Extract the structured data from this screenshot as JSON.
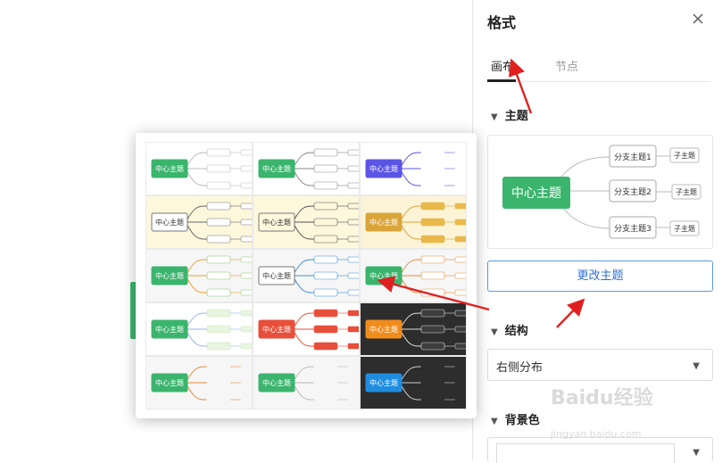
{
  "panel": {
    "title": "格式",
    "tabs": [
      {
        "label": "画布",
        "active": true
      },
      {
        "label": "节点",
        "active": false
      }
    ],
    "theme_section": {
      "label": "主题",
      "preview": {
        "center": "中心主题",
        "branches": [
          "分支主题1",
          "分支主题2",
          "分支主题3"
        ],
        "sub": "子主题"
      },
      "change_button": "更改主题"
    },
    "structure_section": {
      "label": "结构",
      "value": "右侧分布"
    },
    "background_section": {
      "label": "背景色"
    }
  },
  "theme_picker": {
    "center_label": "中心主题",
    "themes": [
      {
        "bg": "#ffffff",
        "center": "#3bb56d",
        "center_text": "#ffffff",
        "line": "#bbbbbb",
        "node": "#ffffff",
        "node_border": "#bbbbbb"
      },
      {
        "bg": "#ffffff",
        "center": "#3bb56d",
        "center_text": "#ffffff",
        "line": "#888888",
        "node": "#ffffff",
        "node_border": "#888888"
      },
      {
        "bg": "#ffffff",
        "center": "#5b55e6",
        "center_text": "#ffffff",
        "line": "#5b55e6",
        "node": "#ffffff",
        "node_border": "#ffffff"
      },
      {
        "bg": "#fdf7dc",
        "center": "#ffffff",
        "center_text": "#333333",
        "line": "#666666",
        "node": "#ffffff",
        "node_border": "#777777"
      },
      {
        "bg": "#fdf7dc",
        "center": "#fdf7dc",
        "center_text": "#333333",
        "line": "#555555",
        "node": "#fdf7dc",
        "node_border": "#555555"
      },
      {
        "bg": "#fdf3d6",
        "center": "#d9a53a",
        "center_text": "#ffffff",
        "line": "#d9a53a",
        "node": "#e8b84a",
        "node_border": "#e8b84a"
      },
      {
        "bg": "#f6f6f6",
        "center": "#3bb56d",
        "center_text": "#ffffff",
        "line": "#f0a030",
        "node": "#ffffff",
        "node_border": "#7ec870"
      },
      {
        "bg": "#f6f6f6",
        "center": "#ffffff",
        "center_text": "#333333",
        "line": "#3d8fd8",
        "node": "#ffffff",
        "node_border": "#3d8fd8"
      },
      {
        "bg": "#f6f6f6",
        "center": "#3bb56d",
        "center_text": "#ffffff",
        "line": "#e88c3a",
        "node": "#ffffff",
        "node_border": "#e88c3a"
      },
      {
        "bg": "#ffffff",
        "center": "#3bb56d",
        "center_text": "#ffffff",
        "line": "#9ab0e8",
        "node": "#e8f5e0",
        "node_border": "#c8e8b0"
      },
      {
        "bg": "#ffffff",
        "center": "#e84f3a",
        "center_text": "#ffffff",
        "line": "#e84f3a",
        "node": "#e84f3a",
        "node_border": "#e84f3a"
      },
      {
        "bg": "#2d2d2d",
        "center": "#f08c1c",
        "center_text": "#ffffff",
        "line": "#dddddd",
        "node": "#3d3d3d",
        "node_border": "#dddddd"
      },
      {
        "bg": "#f6f6f6",
        "center": "#3bb56d",
        "center_text": "#ffffff",
        "line": "#e88c3a",
        "node": "#f6f6f6",
        "node_border": "#f6f6f6"
      },
      {
        "bg": "#f6f6f6",
        "center": "#3bb56d",
        "center_text": "#ffffff",
        "line": "#bbbbbb",
        "node": "#f6f6f6",
        "node_border": "#f6f6f6"
      },
      {
        "bg": "#2d2d2d",
        "center": "#1e8de0",
        "center_text": "#ffffff",
        "line": "#cccccc",
        "node": "#2d2d2d",
        "node_border": "#2d2d2d"
      }
    ]
  },
  "colors": {
    "accent_green": "#3bb56d",
    "button_blue": "#2f6fd4",
    "annotation_red": "#e02020"
  },
  "watermark": {
    "main": "Baidu经验",
    "sub": "jingyan.baidu.com"
  }
}
